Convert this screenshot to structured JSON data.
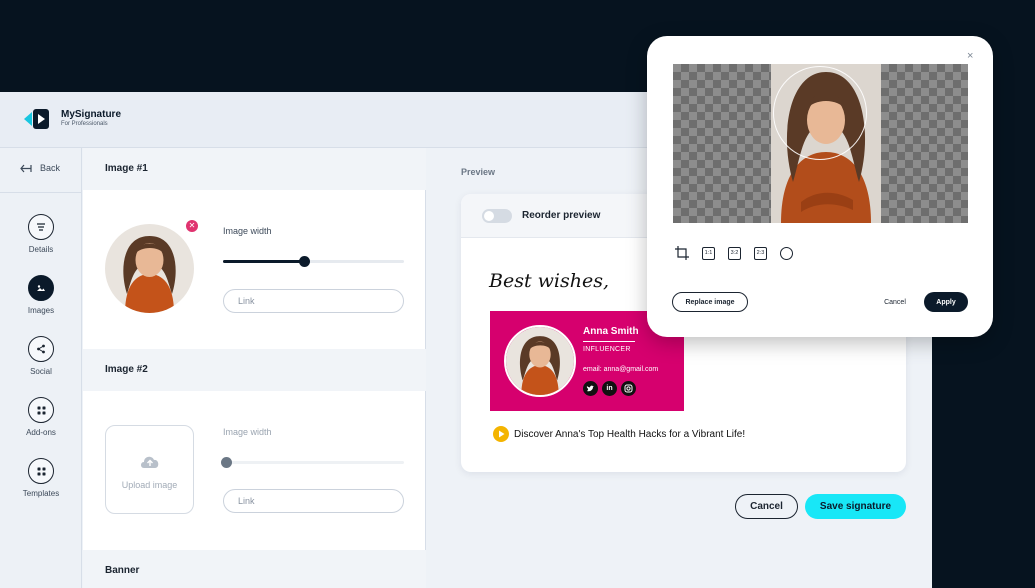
{
  "app": {
    "brand_name": "MySignature",
    "brand_tagline": "For Professionals"
  },
  "sidebar": {
    "back_label": "Back",
    "items": [
      {
        "label": "Details",
        "icon": "list-icon"
      },
      {
        "label": "Images",
        "icon": "image-icon",
        "active": true
      },
      {
        "label": "Social",
        "icon": "share-icon"
      },
      {
        "label": "Add-ons",
        "icon": "grid-icon"
      },
      {
        "label": "Templates",
        "icon": "grid-icon"
      }
    ]
  },
  "editor": {
    "image1": {
      "title": "Image #1",
      "width_label": "Image width",
      "width_value": 0.45,
      "link_placeholder": "Link"
    },
    "image2": {
      "title": "Image #2",
      "upload_label": "Upload image",
      "width_label": "Image width",
      "width_value": 0,
      "link_placeholder": "Link"
    },
    "banner": {
      "title": "Banner"
    }
  },
  "preview": {
    "label": "Preview",
    "reorder_label": "Reorder preview",
    "reorder_on": false,
    "greeting": "Best wishes,",
    "signature": {
      "name": "Anna Smith",
      "role": "INFLUENCER",
      "email": "email: anna@gmail.com",
      "socials": [
        "twitter-icon",
        "linkedin-icon",
        "instagram-icon"
      ],
      "color": "#d6006e"
    },
    "promo_text": "Discover Anna's Top Health Hacks for a Vibrant Life!"
  },
  "actions": {
    "cancel_label": "Cancel",
    "save_label": "Save signature",
    "save_color": "#18e7f7"
  },
  "crop_modal": {
    "close_label": "×",
    "ratios": [
      "1:1",
      "3:2",
      "2:3"
    ],
    "replace_label": "Replace image",
    "cancel_label": "Cancel",
    "apply_label": "Apply"
  }
}
